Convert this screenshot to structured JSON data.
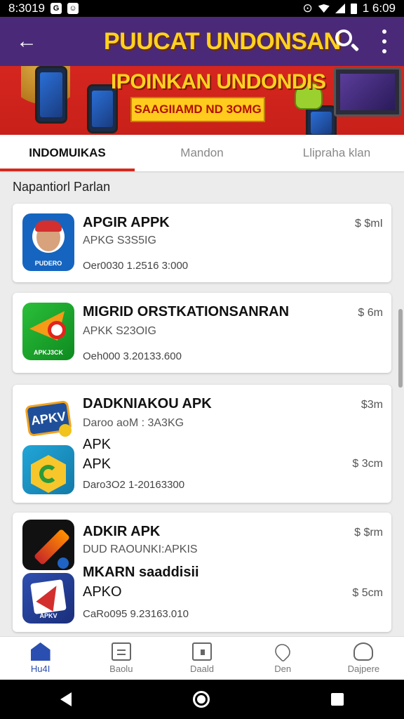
{
  "status_bar": {
    "time": "8:3019",
    "right_time": "1 6:09"
  },
  "app_bar": {
    "title": "PUUCAT UNDONSAN"
  },
  "banner": {
    "headline": "IPOINKAN UNDONDIS",
    "ribbon": "SAAGIIAMD ND 3OMG"
  },
  "tabs": [
    {
      "label": "INDOMUIKAS",
      "active": true
    },
    {
      "label": "Mandon",
      "active": false
    },
    {
      "label": "Llipraha klan",
      "active": false
    }
  ],
  "section_title": "Napantiorl Parlan",
  "cards": [
    {
      "title": "APGIR APPK",
      "sub": "APKG S3S5IG",
      "meta": "Oer0030    1.2516 3:000",
      "price": "$ $mI",
      "icon_label": "PUDERO"
    },
    {
      "title": "MIGRID ORSTKATIONSANRAN",
      "sub": "APKK S23OIG",
      "meta": "Oeh000    3.20133.600",
      "price": "$ 6m",
      "icon_label": "APKJ3CK"
    },
    {
      "title": "DADKNIAKOU APK",
      "sub": "Daroo aoM : 3A3KG",
      "title2": "APK",
      "title3": "APK",
      "meta": "Daro3O2    1-20163300",
      "price": "$3m",
      "price2": "$ 3cm",
      "icon_label": "APKV"
    },
    {
      "title": "ADKIR APK",
      "sub": "DUD RAOUNKI:APKIS",
      "title2": "MKARN saaddisii",
      "title3": "APKO",
      "meta": "CaRo095    9.23163.010",
      "price": "$ $rm",
      "price2": "$ 5cm",
      "icon_label": "APKV"
    }
  ],
  "bottom_nav": [
    {
      "label": "Hu4I",
      "icon": "home-icon",
      "active": true
    },
    {
      "label": "Baolu",
      "icon": "document-icon",
      "active": false
    },
    {
      "label": "Daald",
      "icon": "calendar-icon",
      "active": false
    },
    {
      "label": "Den",
      "icon": "heart-icon",
      "active": false
    },
    {
      "label": "Dajpere",
      "icon": "bell-icon",
      "active": false
    }
  ],
  "colors": {
    "purple": "#4a2a78",
    "red": "#d6281e",
    "yellow": "#ffd21f",
    "blue": "#2b4fb0"
  }
}
